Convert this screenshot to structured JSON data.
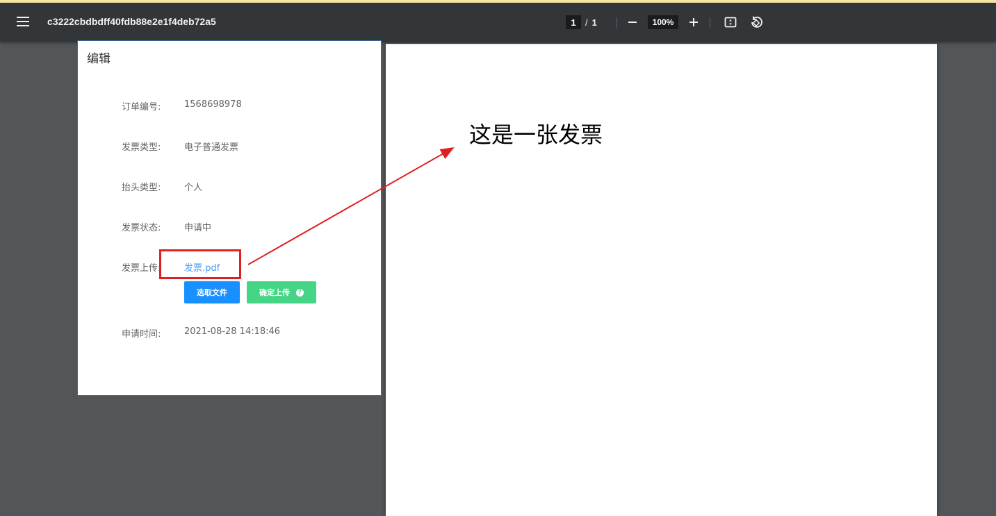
{
  "toolbar": {
    "title": "c3222cbdbdff40fdb88e2e1f4deb72a5",
    "page_current": "1",
    "page_separator": "/",
    "page_total": "1",
    "zoom": "100%",
    "icons": [
      "menu-icon",
      "zoom-out-icon",
      "zoom-in-icon",
      "fit-page-icon",
      "rotate-icon"
    ]
  },
  "pdf": {
    "text": "这是一张发票"
  },
  "dialog": {
    "title": "编辑",
    "fields": [
      {
        "label": "订单编号:",
        "value": "1568698978"
      },
      {
        "label": "发票类型:",
        "value": "电子普通发票"
      },
      {
        "label": "抬头类型:",
        "value": "个人"
      },
      {
        "label": "发票状态:",
        "value": "申请中"
      },
      {
        "label": "发票上传:",
        "value": "发票.pdf"
      },
      {
        "label": "申请时间:",
        "value": "2021-08-28 14:18:46"
      }
    ],
    "select_file_button": "选取文件",
    "confirm_upload_button": "确定上传",
    "help_glyph": "?"
  },
  "colors": {
    "toolbar_bg": "#323639",
    "viewer_bg": "#525659",
    "link": "#409eff",
    "primary_button": "#1890ff",
    "success_button": "#46d586",
    "annotation": "#e02020"
  }
}
